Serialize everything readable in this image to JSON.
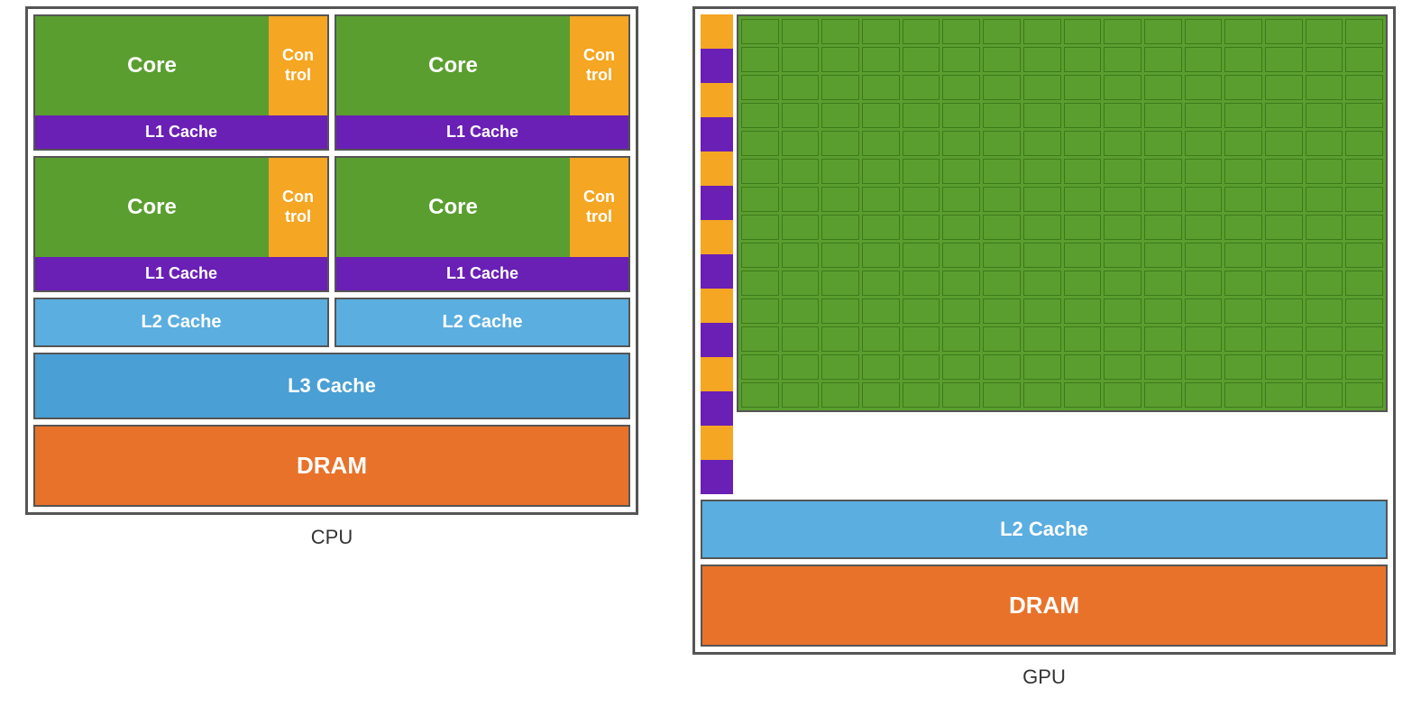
{
  "cpu": {
    "label": "CPU",
    "cores": [
      {
        "core_label": "Core",
        "control_label": "Con\ntrol",
        "l1_label": "L1 Cache"
      },
      {
        "core_label": "Core",
        "control_label": "Con\ntrol",
        "l1_label": "L1 Cache"
      },
      {
        "core_label": "Core",
        "control_label": "Con\ntrol",
        "l1_label": "L1 Cache"
      },
      {
        "core_label": "Core",
        "control_label": "Con\ntrol",
        "l1_label": "L1 Cache"
      }
    ],
    "l2_caches": [
      "L2 Cache",
      "L2 Cache"
    ],
    "l3_cache": "L3  Cache",
    "dram": "DRAM"
  },
  "gpu": {
    "label": "GPU",
    "grid_cols": 16,
    "grid_rows": 14,
    "sidebar_stripes": 14,
    "l2_cache": "L2 Cache",
    "dram": "DRAM",
    "colors": {
      "stripe_a": "#f5a623",
      "stripe_b": "#6a1fb5"
    }
  },
  "colors": {
    "green": "#5a9e2f",
    "orange_control": "#f5a623",
    "purple": "#6a1fb5",
    "blue_light": "#5baee0",
    "blue_mid": "#4a9fd4",
    "orange_dram": "#e8722a"
  }
}
